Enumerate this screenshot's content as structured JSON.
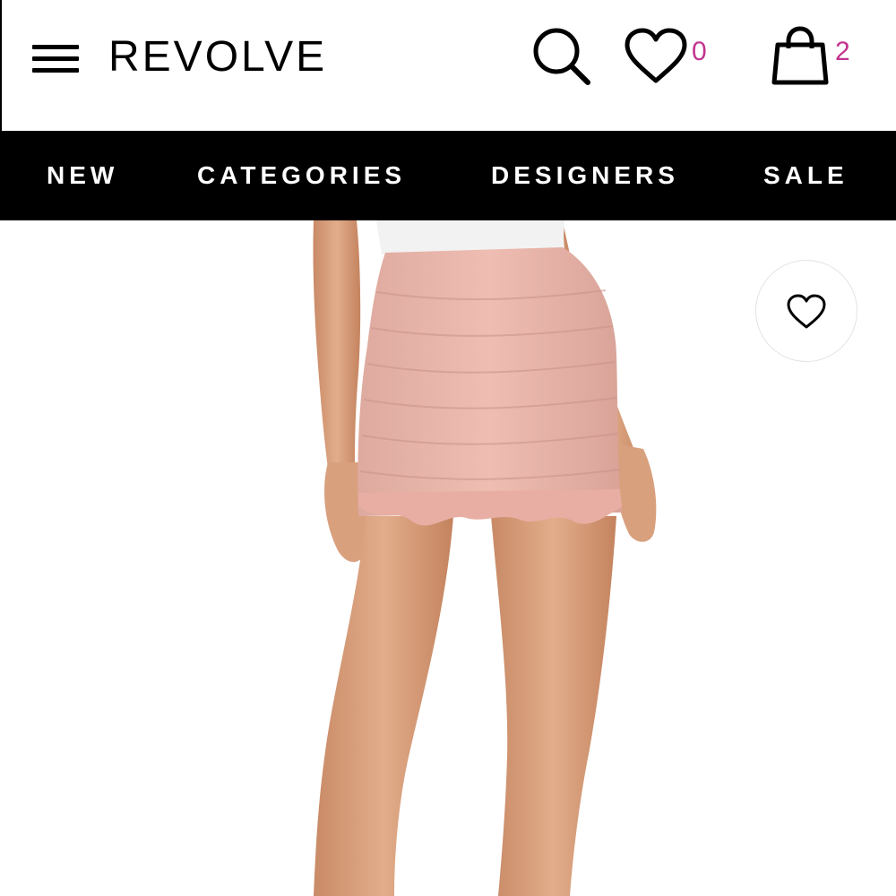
{
  "header": {
    "logo": "REVOLVE",
    "wishlist_count": "0",
    "bag_count": "2",
    "icons": {
      "menu": "hamburger-menu-icon",
      "search": "search-icon",
      "wishlist": "heart-icon",
      "bag": "shopping-bag-icon"
    },
    "accent_color": "#c2338f"
  },
  "nav": {
    "items": [
      {
        "label": "NEW"
      },
      {
        "label": "CATEGORIES"
      },
      {
        "label": "DESIGNERS"
      },
      {
        "label": "SALE"
      }
    ]
  },
  "product": {
    "image_subject": "model wearing blush pink ruched mini skirt with ruffle hem and white top",
    "skirt_color": "#e8b1a8",
    "add_to_wishlist_icon": "heart-outline-icon"
  }
}
